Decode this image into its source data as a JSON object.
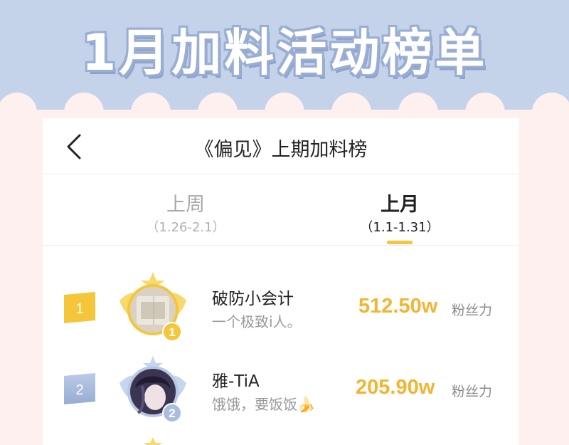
{
  "banner": {
    "title": "1月加料活动榜单"
  },
  "header": {
    "title": "《偏见》上期加料榜"
  },
  "tabs": [
    {
      "label": "上周",
      "range": "（1.26-2.1）",
      "active": false
    },
    {
      "label": "上月",
      "range": "（1.1-1.31）",
      "active": true
    }
  ],
  "ranking": [
    {
      "rank": "1",
      "name": "破防小会计",
      "bio": "一个极致i人。",
      "score": "512.50w",
      "unit": "粉丝力",
      "badge_color": "#f5c63a",
      "medal": "1"
    },
    {
      "rank": "2",
      "name": "雅-TiA",
      "bio": "饿饿，要饭饭🍌",
      "score": "205.90w",
      "unit": "粉丝力",
      "badge_color": "#a9bedf",
      "medal": "2"
    }
  ],
  "colors": {
    "banner": "#c5d3ea",
    "accent": "#f5c63a",
    "score": "#f2b531"
  },
  "icons": {
    "back": "chevron-left-icon"
  }
}
